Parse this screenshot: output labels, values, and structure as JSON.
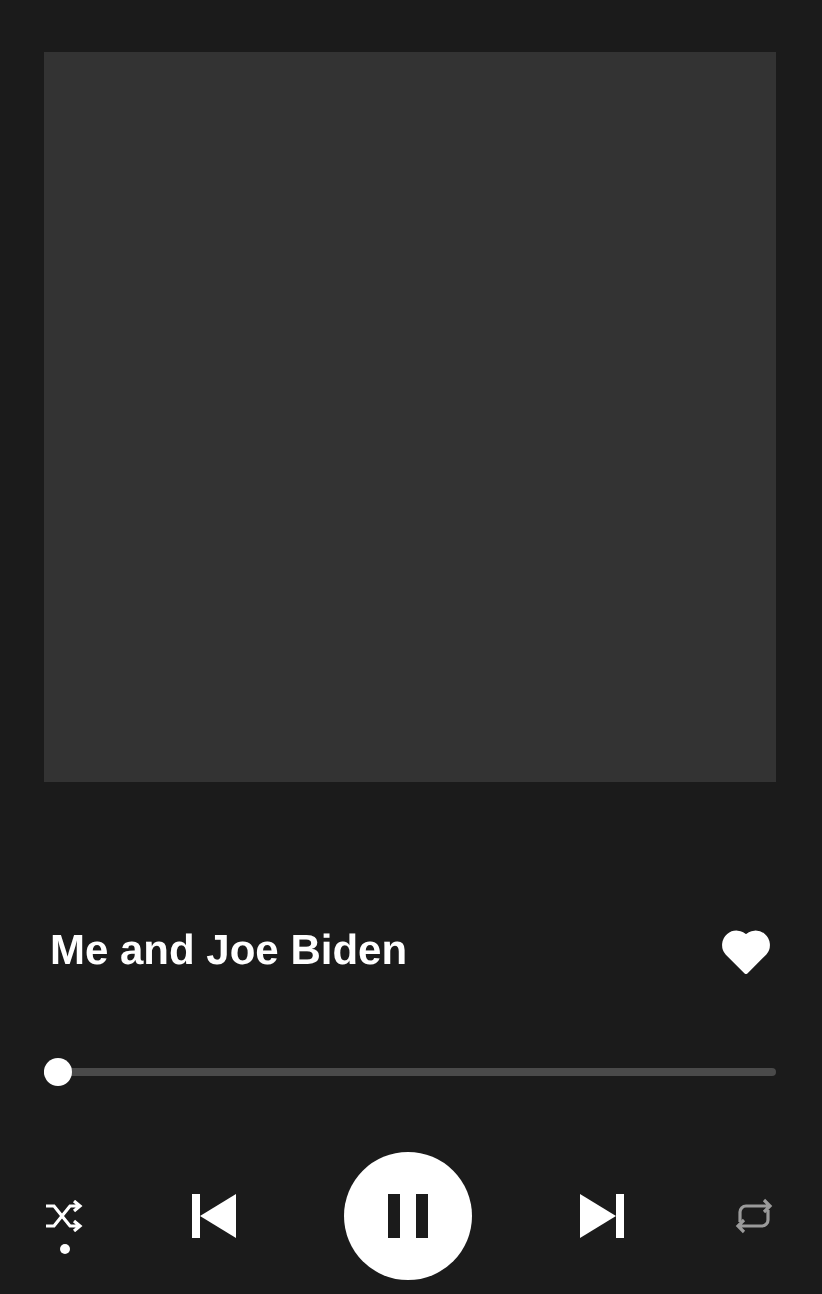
{
  "track": {
    "title": "Me and Joe Biden",
    "liked": true
  },
  "progress": {
    "level": 0.02
  },
  "controls": {
    "shuffle": true,
    "playing": true,
    "repeat": false
  }
}
